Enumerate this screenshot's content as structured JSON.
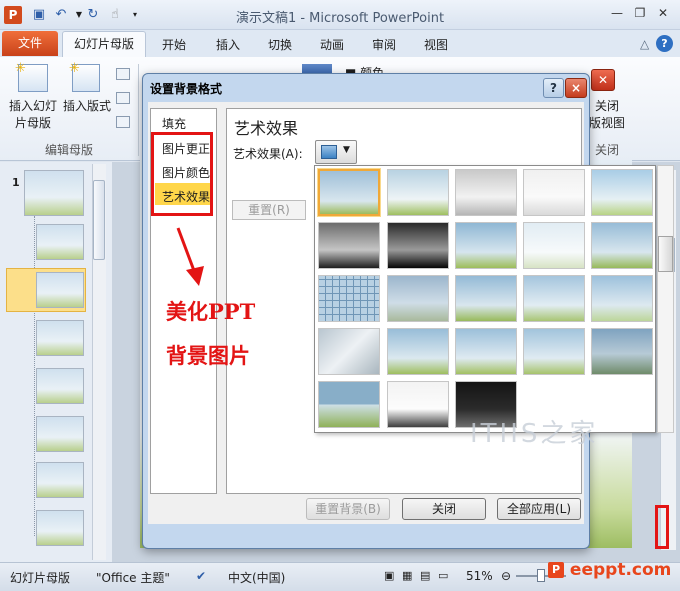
{
  "window": {
    "title": "演示文稿1 - Microsoft PowerPoint",
    "app_icon": "P"
  },
  "tabs": {
    "file": "文件",
    "slide_master": "幻灯片母版",
    "home": "开始",
    "insert": "插入",
    "transitions": "切换",
    "animations": "动画",
    "review": "审阅",
    "view": "视图"
  },
  "ribbon": {
    "insert_slide_master_l1": "插入幻灯",
    "insert_slide_master_l2": "片母版",
    "insert_layout_l1": "插入版式",
    "group_edit_master": "编辑母版",
    "close_l1": "关闭",
    "close_l2": "版视图",
    "group_close": "关闭",
    "theme_label": "颜色"
  },
  "thumbnails": {
    "first_number": "1"
  },
  "dialog": {
    "title": "设置背景格式",
    "help": "?",
    "close": "×",
    "nav": [
      "填充",
      "图片更正",
      "图片颜色",
      "艺术效果"
    ],
    "section_title": "艺术效果",
    "art_effect_label": "艺术效果(A):",
    "reset": "重置(R)",
    "reset_background": "重置背景(B)",
    "close_button": "关闭",
    "apply_all": "全部应用(L)"
  },
  "annotation": {
    "line1": "美化PPT",
    "line2": "背景图片"
  },
  "watermark": {
    "text": "ITIIS之家",
    "site": "eeppt.com"
  },
  "statusbar": {
    "view_name": "幻灯片母版",
    "theme": "\"Office 主题\"",
    "language": "中文(中国)",
    "zoom": "51%"
  },
  "colors": {
    "file_tab": "#d24a1d",
    "highlight": "#ffd64a",
    "annotation": "#e31414",
    "dialog_frame": "#c3d7ee"
  }
}
